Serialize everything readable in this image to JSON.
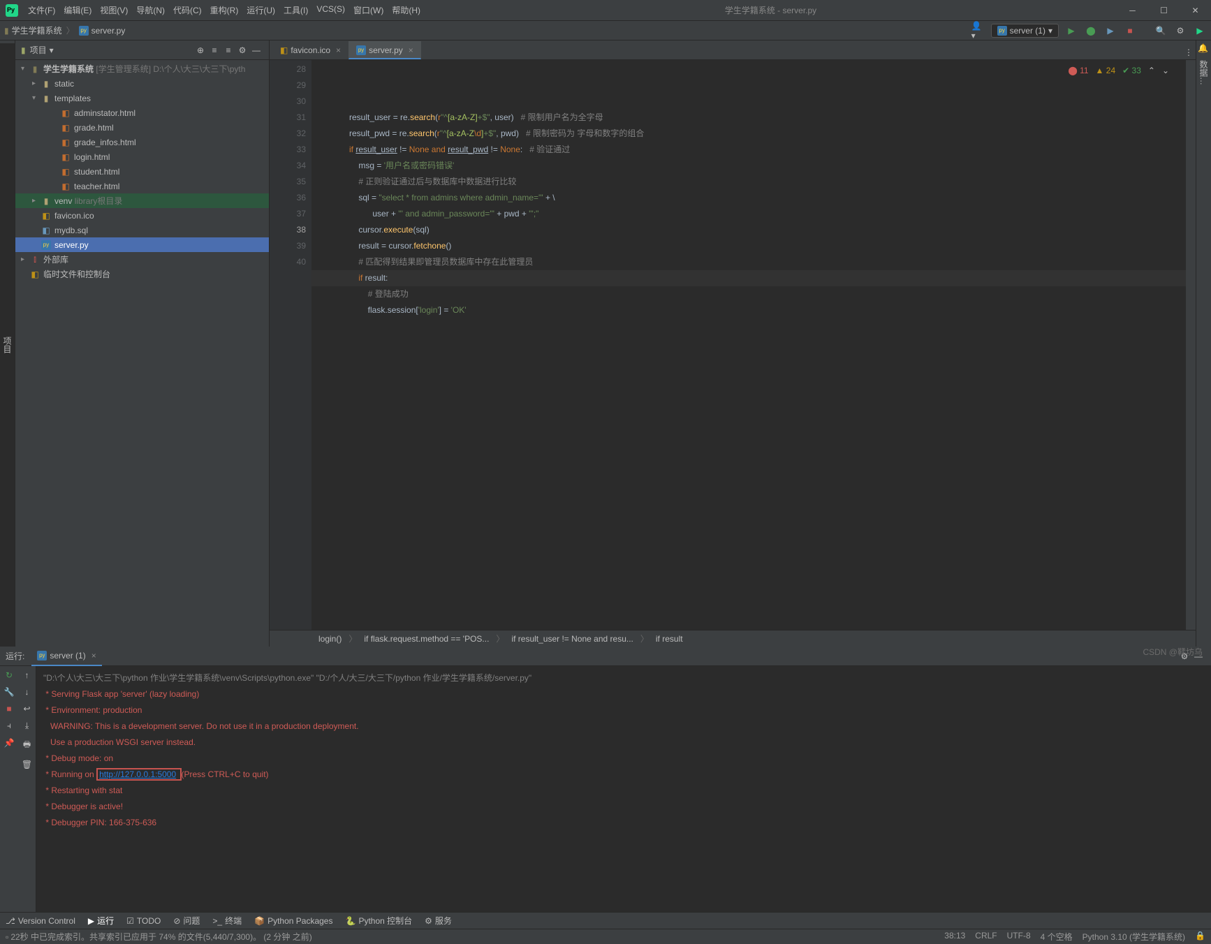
{
  "window": {
    "title": "学生学籍系统 - server.py"
  },
  "menus": [
    "文件(F)",
    "编辑(E)",
    "视图(V)",
    "导航(N)",
    "代码(C)",
    "重构(R)",
    "运行(U)",
    "工具(I)",
    "VCS(S)",
    "窗口(W)",
    "帮助(H)"
  ],
  "breadcrumbs": {
    "root": "学生学籍系统",
    "file": "server.py"
  },
  "run_config": {
    "name": "server (1)"
  },
  "project_panel": {
    "title": "项目"
  },
  "tree": {
    "root": {
      "name": "学生学籍系统",
      "hint": "[学生管理系统]",
      "path": "D:\\个人\\大三\\大三下\\pyth"
    },
    "static": "static",
    "templates": "templates",
    "t_files": [
      "adminstator.html",
      "grade.html",
      "grade_infos.html",
      "login.html",
      "student.html",
      "teacher.html"
    ],
    "venv": {
      "name": "venv",
      "hint": "library根目录"
    },
    "files": [
      "favicon.ico",
      "mydb.sql",
      "server.py"
    ],
    "ext": "外部库",
    "scratch": "临时文件和控制台"
  },
  "tabs": [
    {
      "name": "favicon.ico"
    },
    {
      "name": "server.py"
    }
  ],
  "inspection": {
    "err": "11",
    "warn": "24",
    "ok": "33"
  },
  "code": {
    "start": 28,
    "lines": [
      {
        "n": 28,
        "html": "            result_user = re.<span class='fn'>search</span>(<span class='kw'>r</span><span class='str'>\"^</span><span class='reg'>[a-zA-Z]</span><span class='str'>+$\"</span>, user)   <span class='cmt'># 限制用户名为全字母</span>"
      },
      {
        "n": 29,
        "html": "            result_pwd = re.<span class='fn'>search</span>(<span class='kw'>r</span><span class='str'>\"^</span><span class='reg'>[a-zA-Z</span><span class='esc'>\\d</span><span class='reg'>]</span><span class='str'>+$\"</span>, pwd)   <span class='cmt'># 限制密码为 字母和数字的组合</span>"
      },
      {
        "n": 30,
        "html": "            <span class='kw'>if</span> <u>result_user</u> != <span class='none'>None</span> <span class='kw'>and</span> <u>result_pwd</u> != <span class='none'>None</span>:   <span class='cmt'># 验证通过</span>"
      },
      {
        "n": 31,
        "html": "                msg = <span class='str'>'用户名或密码错误'</span>"
      },
      {
        "n": 32,
        "html": "                <span class='cmt'># 正则验证通过后与数据库中数据进行比较</span>"
      },
      {
        "n": 33,
        "html": "                sql = <span class='str'>\"select * from admins where admin_name='\"</span> + \\"
      },
      {
        "n": 34,
        "html": "                      user + <span class='str'>\"' and admin_password='\"</span> + pwd + <span class='str'>\"';\"</span>"
      },
      {
        "n": 35,
        "html": "                cursor.<span class='fn'>execute</span>(sql)"
      },
      {
        "n": 36,
        "html": "                result = cursor.<span class='fn'>fetchone</span>()"
      },
      {
        "n": 37,
        "html": "                <span class='cmt'># 匹配得到结果即管理员数据库中存在此管理员</span>"
      },
      {
        "n": 38,
        "html": "                <span class='kw'>if</span> result:",
        "cur": true
      },
      {
        "n": 39,
        "html": "                    <span class='cmt'># 登陆成功</span>"
      },
      {
        "n": 40,
        "html": "                    flask.session[<span class='str'>'login'</span>] = <span class='str'>'OK'</span>"
      }
    ]
  },
  "editor_crumbs": [
    "login()",
    "if flask.request.method == 'POS...",
    "if result_user != None and resu...",
    "if result"
  ],
  "run": {
    "label": "运行:",
    "tab": "server (1)",
    "lines": [
      {
        "cls": "gray",
        "text": "\"D:\\个人\\大三\\大三下\\python 作业\\学生学籍系统\\venv\\Scripts\\python.exe\" \"D:/个人/大三/大三下/python 作业/学生学籍系统/server.py\""
      },
      {
        "cls": "red",
        "text": " * Serving Flask app 'server' (lazy loading)"
      },
      {
        "cls": "red",
        "text": " * Environment: production"
      },
      {
        "cls": "red",
        "text": "   WARNING: This is a development server. Do not use it in a production deployment."
      },
      {
        "cls": "red",
        "text": "   Use a production WSGI server instead."
      },
      {
        "cls": "red",
        "text": " * Debug mode: on"
      },
      {
        "cls": "red",
        "html": " * Running on <span class='hlbox'><span class='link'>http://127.0.0.1:5000</span> </span>(Press CTRL+C to quit)"
      },
      {
        "cls": "red",
        "text": " * Restarting with stat"
      },
      {
        "cls": "red",
        "text": " * Debugger is active!"
      },
      {
        "cls": "red",
        "text": " * Debugger PIN: 166-375-636"
      }
    ]
  },
  "bottom_tools": [
    "Version Control",
    "运行",
    "TODO",
    "问题",
    "终端",
    "Python Packages",
    "Python 控制台",
    "服务"
  ],
  "status": {
    "left": "22秒 中已完成索引。共享索引已应用于 74% 的文件(5,440/7,300)。 (2 分钟 之前)",
    "pos": "38:13",
    "eol": "CRLF",
    "enc": "UTF-8",
    "indent": "4 个空格",
    "interp": "Python 3.10 (学生学籍系统)"
  },
  "watermark": "CSDN @鞣坊乌"
}
